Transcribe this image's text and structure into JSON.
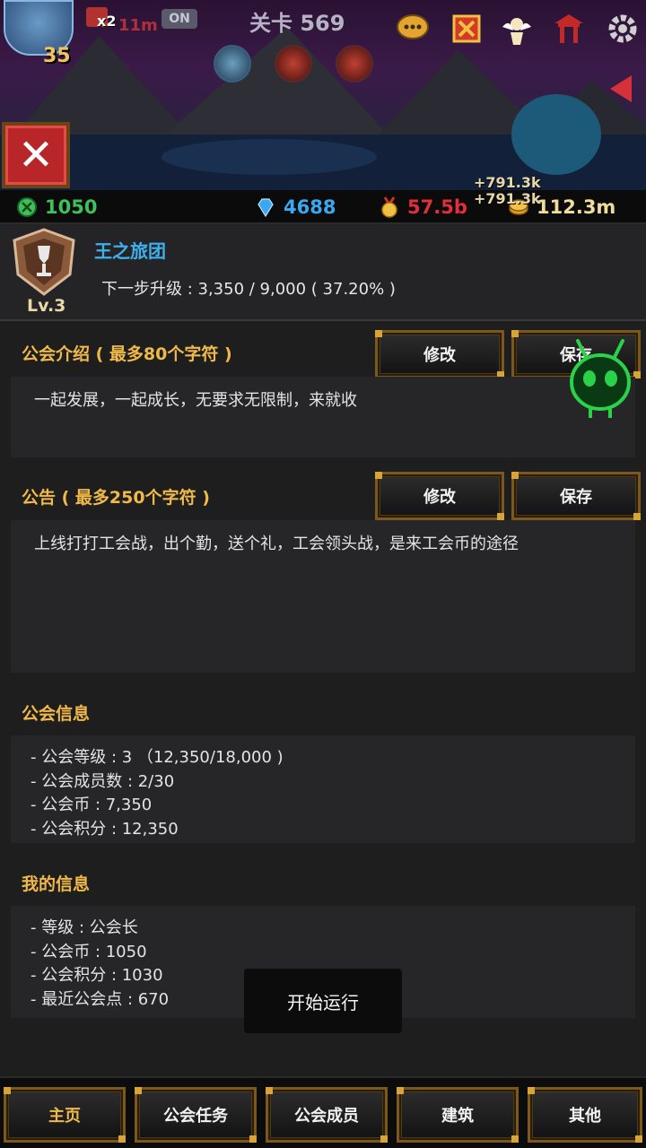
{
  "hud": {
    "hero_level": "35",
    "speed": "x2",
    "timer": "11m",
    "auto_toggle": "ON",
    "stage": "关卡 569",
    "floating_gains": [
      "+791.3k",
      "+791.3k"
    ]
  },
  "resources": {
    "guild_coin": "1050",
    "gems": "4688",
    "medals": "57.5b",
    "gold": "112.3m"
  },
  "guild": {
    "name": "王之旅团",
    "level": "Lv.3",
    "next_level": "下一步升级 : 3,350 / 9,000 ( 37.20% )",
    "next_level_fraction": 0.372
  },
  "intro": {
    "title": "公会介绍 ( 最多80个字符 )",
    "text": "一起发展，一起成长，无要求无限制，来就收",
    "edit_label": "修改",
    "save_label": "保存"
  },
  "notice": {
    "title": "公告 ( 最多250个字符 )",
    "text": "上线打打工会战，出个勤，送个礼，工会领头战，是来工会币的途径",
    "edit_label": "修改",
    "save_label": "保存"
  },
  "guild_info": {
    "title": "公会信息",
    "lines": [
      "- 公会等级 : 3 （12,350/18,000 )",
      "- 公会成员数 : 2/30",
      "- 公会币 : 7,350",
      "- 公会积分 : 12,350"
    ]
  },
  "my_info": {
    "title": "我的信息",
    "lines": [
      "- 等级 : 公会长",
      "- 公会币 : 1050",
      "- 公会积分 : 1030",
      "- 最近公会点 : 670"
    ]
  },
  "toast": "开始运行",
  "nav": [
    "主页",
    "公会任务",
    "公会成员",
    "建筑",
    "其他"
  ],
  "colors": {
    "accent_gold": "#f0b94a",
    "guild_name_blue": "#3fb0ee",
    "coin_green": "#3ec05a",
    "gem_blue": "#3aa8f0",
    "medal_red": "#e0303a",
    "close_red": "#b8262a"
  }
}
